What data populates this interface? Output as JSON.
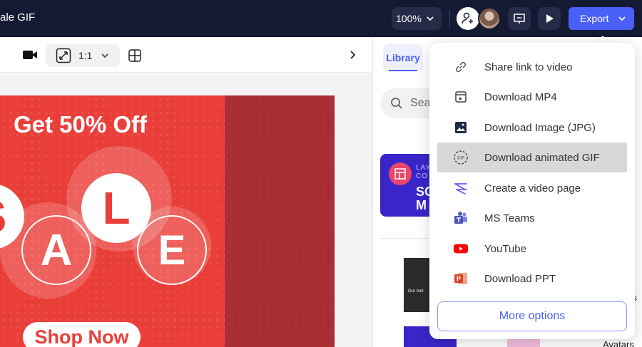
{
  "header": {
    "doc_title": "ale GIF",
    "zoom_value": "100%",
    "export_label": "Export"
  },
  "toolbar": {
    "ratio_label": "1:1"
  },
  "slide": {
    "headline": "Get 50% Off",
    "letters": [
      "S",
      "A",
      "L",
      "E"
    ],
    "cta": "Shop Now",
    "colors": {
      "primary": "#ea3e39",
      "dark": "#a92f33"
    }
  },
  "right_panel": {
    "tab_library": "Library",
    "search_placeholder": "Sea",
    "layout_card": {
      "line1": "LAY",
      "line2": "CO",
      "line3": "SO",
      "line4": "M"
    },
    "thumb_text": "Our mot",
    "side_label_1": "ars",
    "side_label_2": "Avatars"
  },
  "export_menu": {
    "items": [
      {
        "label": "Share link to video",
        "icon": "link-icon"
      },
      {
        "label": "Download MP4",
        "icon": "video-file-icon"
      },
      {
        "label": "Download Image (JPG)",
        "icon": "image-icon"
      },
      {
        "label": "Download animated GIF",
        "icon": "gif-icon",
        "active": true
      },
      {
        "label": "Create a video page",
        "icon": "video-page-icon"
      },
      {
        "label": "MS Teams",
        "icon": "ms-teams-icon"
      },
      {
        "label": "YouTube",
        "icon": "youtube-icon"
      },
      {
        "label": "Download PPT",
        "icon": "powerpoint-icon"
      }
    ],
    "more_label": "More options"
  },
  "colors": {
    "accent": "#4a5ff5",
    "topbar": "#141a33"
  }
}
